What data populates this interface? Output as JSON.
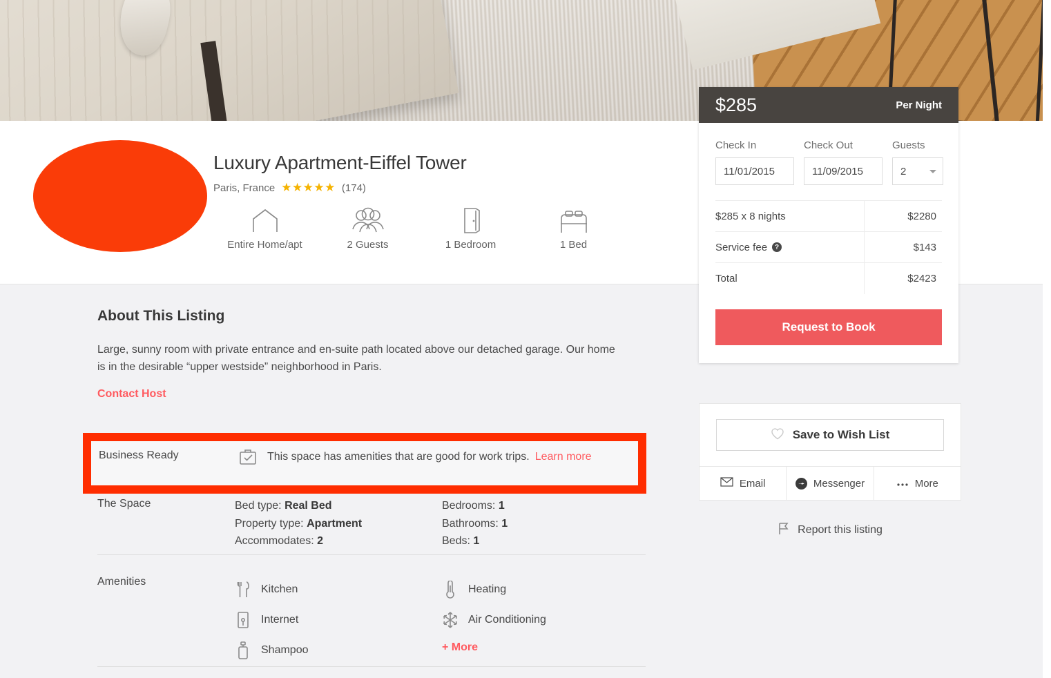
{
  "hero": {
    "alt": "apartment-interior-photo"
  },
  "listing": {
    "title": "Luxury Apartment-Eiffel Tower",
    "location": "Paris, France",
    "stars": "★★★★★",
    "review_count": "(174)",
    "facts": [
      {
        "icon": "house-icon",
        "label": "Entire Home/apt"
      },
      {
        "icon": "guests-icon",
        "label": "2 Guests"
      },
      {
        "icon": "door-icon",
        "label": "1 Bedroom"
      },
      {
        "icon": "bed-icon",
        "label": "1 Bed"
      }
    ]
  },
  "about": {
    "heading": "About This Listing",
    "description": "Large, sunny room with private entrance and en-suite path located above our detached garage. Our home is in the desirable “upper westside” neighborhood in Paris.",
    "contact_host": "Contact Host"
  },
  "business_ready": {
    "label": "Business Ready",
    "icon": "briefcase-check-icon",
    "text": "This space has amenities that are good for work trips.",
    "learn_more": "Learn more",
    "highlight_color": "#ff2d00"
  },
  "the_space": {
    "label": "The Space",
    "column1": [
      {
        "key": "Bed type:",
        "value": "Real Bed"
      },
      {
        "key": "Property type:",
        "value": "Apartment"
      },
      {
        "key": "Accommodates:",
        "value": "2"
      }
    ],
    "column2": [
      {
        "key": "Bedrooms:",
        "value": "1"
      },
      {
        "key": "Bathrooms:",
        "value": "1"
      },
      {
        "key": "Beds:",
        "value": "1"
      }
    ]
  },
  "amenities": {
    "label": "Amenities",
    "column1": [
      {
        "icon": "utensils-icon",
        "name": "Kitchen"
      },
      {
        "icon": "wifi-router-icon",
        "name": "Internet"
      },
      {
        "icon": "shampoo-bottle-icon",
        "name": "Shampoo"
      }
    ],
    "column2": [
      {
        "icon": "thermometer-icon",
        "name": "Heating"
      },
      {
        "icon": "snowflake-icon",
        "name": "Air Conditioning"
      }
    ],
    "more": "+ More"
  },
  "booking": {
    "price": "$285",
    "per_unit": "Per Night",
    "checkin_label": "Check In",
    "checkin_value": "11/01/2015",
    "checkout_label": "Check Out",
    "checkout_value": "11/09/2015",
    "guests_label": "Guests",
    "guests_value": "2",
    "rows": [
      {
        "label": "$285 x 8 nights",
        "amount": "$2280",
        "help": false
      },
      {
        "label": "Service fee",
        "amount": "$143",
        "help": true
      },
      {
        "label": "Total",
        "amount": "$2423",
        "help": false
      }
    ],
    "help_glyph": "?",
    "cta": "Request to Book",
    "cta_color": "#ef5a5d",
    "header_bg": "#484440"
  },
  "sidebar": {
    "wishlist_label": "Save to Wish List",
    "wishlist_icon": "heart-icon",
    "share": [
      {
        "icon": "envelope-icon",
        "label": "Email"
      },
      {
        "icon": "messenger-icon",
        "label": "Messenger"
      },
      {
        "icon": "ellipsis-icon",
        "label": "More"
      }
    ],
    "report_label": "Report this listing",
    "report_icon": "flag-icon"
  },
  "colors": {
    "accent_red": "#ff5a5f",
    "annotation_red": "#ff2d00",
    "avatar_overlay": "#fa3c08",
    "star_gold": "#f5b301",
    "page_bg": "#f2f2f4"
  }
}
